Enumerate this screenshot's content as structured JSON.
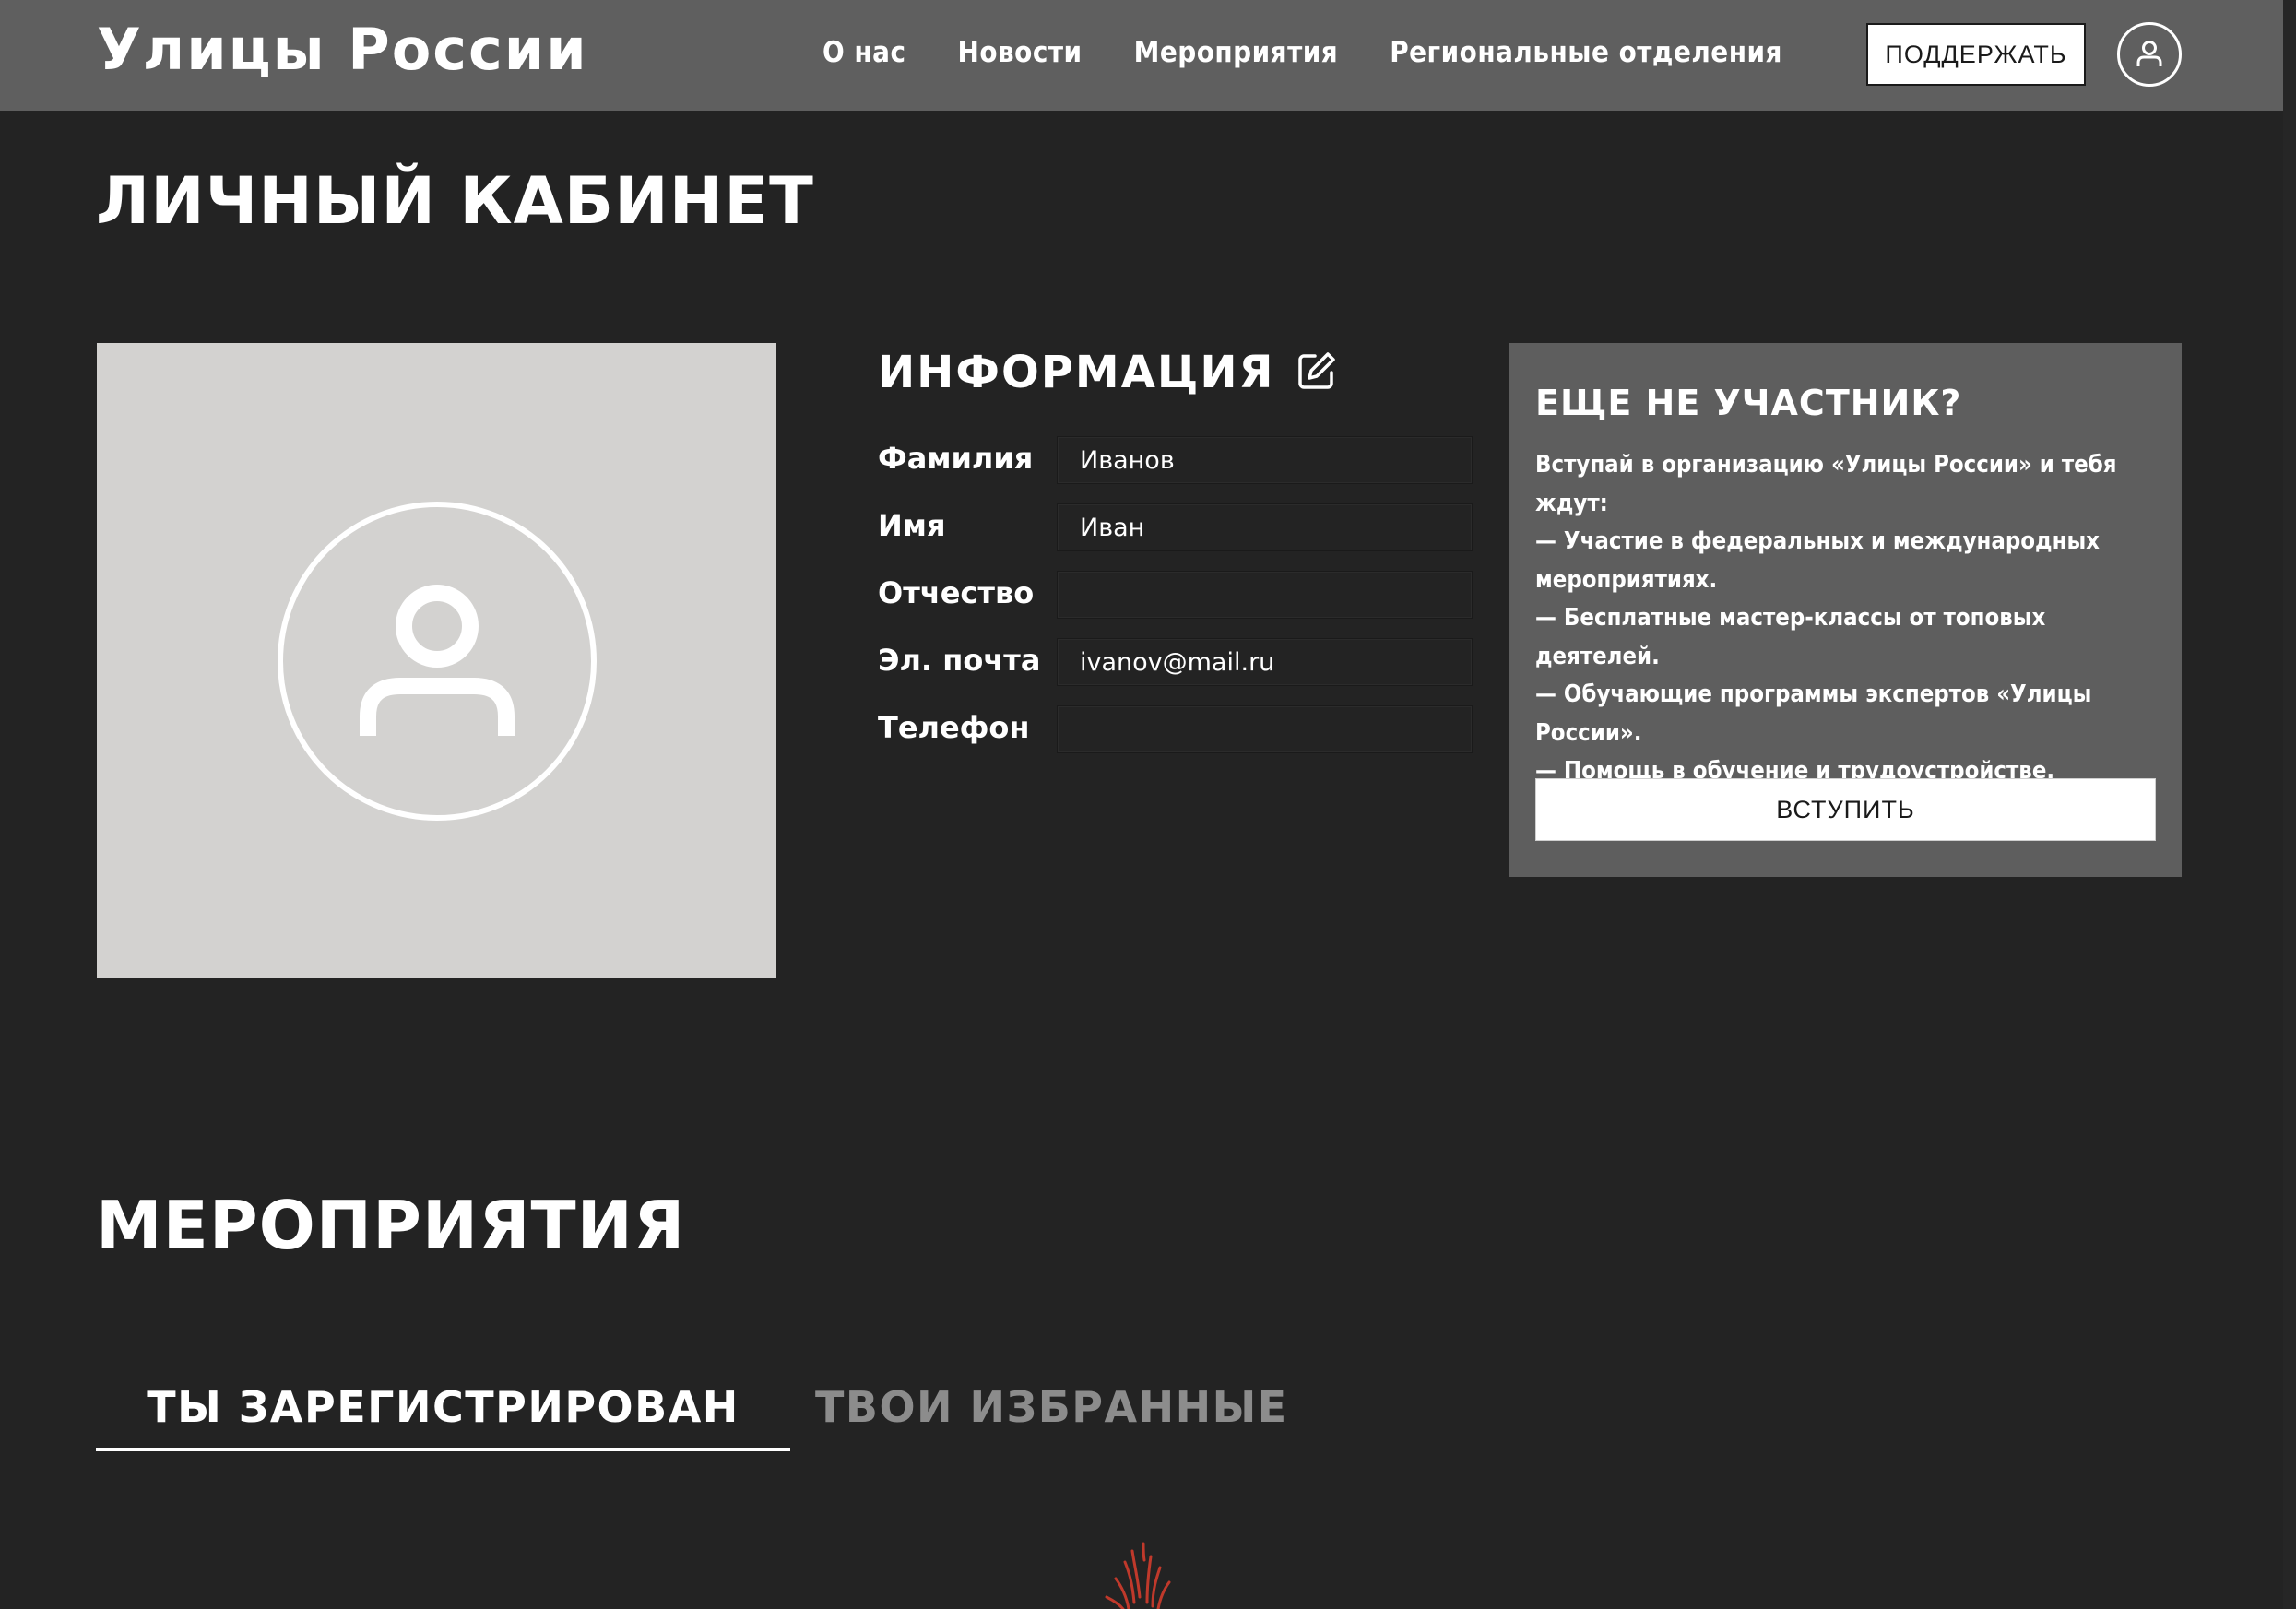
{
  "header": {
    "logo": "Улицы России",
    "nav": [
      "О нас",
      "Новости",
      "Мероприятия",
      "Региональные отделения"
    ],
    "support_label": "ПОДДЕРЖАТЬ",
    "profile_icon": "user-circle-icon"
  },
  "page": {
    "title": "ЛИЧНЫЙ КАБИНЕТ"
  },
  "avatar": {
    "icon": "user-placeholder-icon"
  },
  "info": {
    "title": "ИНФОРМАЦИЯ",
    "edit_icon": "edit-icon",
    "fields": [
      {
        "label": "Фамилия",
        "value": "Иванов"
      },
      {
        "label": "Имя",
        "value": "Иван"
      },
      {
        "label": "Отчество",
        "value": ""
      },
      {
        "label": "Эл. почта",
        "value": "ivanov@mail.ru"
      },
      {
        "label": "Телефон",
        "value": ""
      }
    ]
  },
  "join": {
    "title": "ЕЩЕ НЕ УЧАСТНИК?",
    "lines": [
      "Вступай в организацию «Улицы России» и тебя ждут:",
      "— Участие в федеральных и международных мероприятиях.",
      "— Бесплатные мастер-классы от топовых деятелей.",
      "— Обучающие программы экспертов «Улицы России».",
      "— Помощь в обучение и трудоустройстве."
    ],
    "button_label": "ВСТУПИТЬ"
  },
  "events": {
    "title": "МЕРОПРИЯТИЯ",
    "tabs": [
      "ТЫ ЗАРЕГИСТРИРОВАН",
      "ТВОИ ИЗБРАННЫЕ"
    ],
    "active_tab": "ТЫ ЗАРЕГИСТРИРОВАН"
  },
  "colors": {
    "background": "#232323",
    "header": "#5f5f5f",
    "panel": "#5e5e5e",
    "avatar_box": "#d3d2d0",
    "inactive_tab": "#8c8c8c",
    "accent_art": "#c0392b"
  }
}
